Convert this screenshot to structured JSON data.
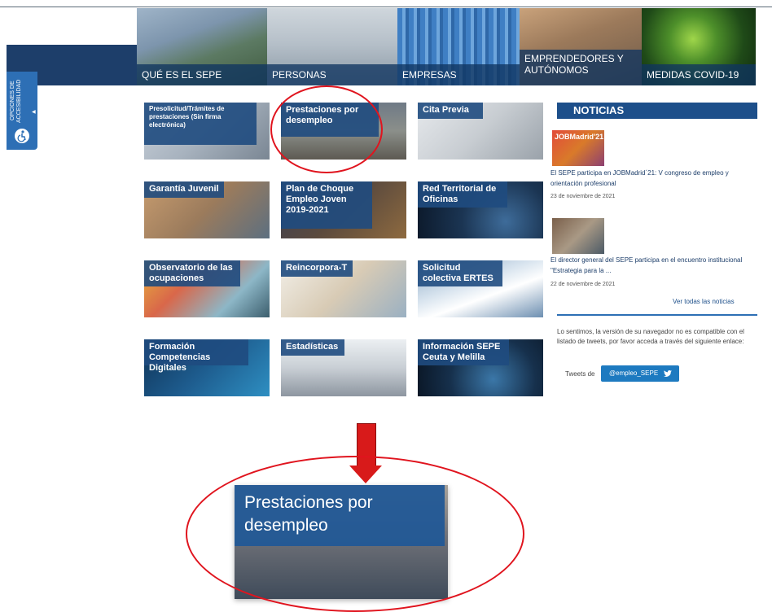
{
  "nav": {
    "items": [
      {
        "label": "QUÉ ES EL SEPE"
      },
      {
        "label": "PERSONAS"
      },
      {
        "label": "EMPRESAS"
      },
      {
        "label": "EMPRENDEDORES Y AUTÓNOMOS"
      },
      {
        "label": "MEDIDAS COVID-19"
      }
    ]
  },
  "accessibility": {
    "label": "OPCIONES DE ACCESIBILIDAD",
    "icon": "wheelchair-icon"
  },
  "tiles": [
    {
      "label": "Presolicitud/Trámites de prestaciones (Sin firma electrónica)"
    },
    {
      "label": "Prestaciones por desempleo"
    },
    {
      "label": "Cita Previa"
    },
    {
      "label": "Garantía Juvenil"
    },
    {
      "label": "Plan de Choque Empleo Joven 2019-2021"
    },
    {
      "label": "Red Territorial de Oficinas"
    },
    {
      "label": "Observatorio de las ocupaciones"
    },
    {
      "label": "Reincorpora-T"
    },
    {
      "label": "Solicitud colectiva ERTES"
    },
    {
      "label": "Formación Competencias Digitales"
    },
    {
      "label": "Estadísticas"
    },
    {
      "label": "Información SEPE Ceuta y Melilla"
    }
  ],
  "news": {
    "title": "NOTICIAS",
    "items": [
      {
        "text": "El SEPE participa en JOBMadrid´21: V congreso de empleo y orientación profesional",
        "date": "23 de noviembre de 2021",
        "image_text": "JOBMadrid'21"
      },
      {
        "text": "El director general del SEPE participa en el encuentro institucional \"Estrategia para la ...",
        "date": "22 de noviembre de 2021"
      }
    ],
    "see_all": "Ver todas las noticias"
  },
  "twitter": {
    "message": "Lo sentimos, la versión de su navegador no es compatible con el listado de tweets, por favor acceda a través del siguiente enlace:",
    "prefix": "Tweets de",
    "handle": "@empleo_SEPE"
  },
  "zoom": {
    "label": "Prestaciones por desempleo"
  },
  "colors": {
    "brand_blue": "#1d3e6a",
    "tile_blue": "#1f4b80",
    "highlight_red": "#e0141e"
  }
}
